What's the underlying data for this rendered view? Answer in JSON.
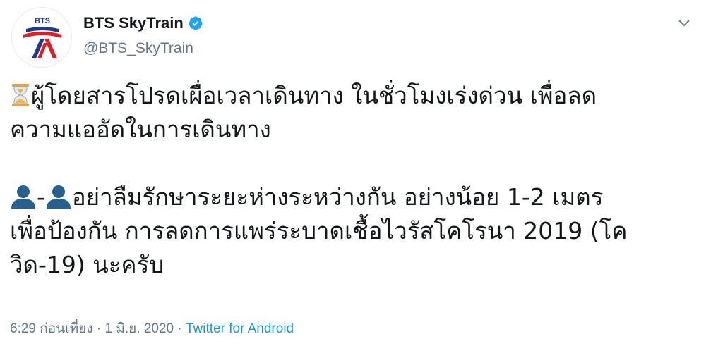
{
  "account": {
    "avatar_label": "BTS",
    "display_name": "BTS SkyTrain",
    "handle": "@BTS_SkyTrain",
    "verified": true
  },
  "tweet": {
    "line1": "ผู้โดยสารโปรดเผื่อเวลาเดินทาง ในชั่วโมงเร่งด่วน เพื่อลด",
    "line2": "ความแออัดในการเดินทาง",
    "line3_sep": "-",
    "line3": "อย่าลืมรักษาระยะห่างระหว่างกัน อย่างน้อย 1-2 เมตร",
    "line4": "เพื่อป้องกัน การลดการแพร่ระบาดเชื้อไวรัสโคโรนา 2019 (โค",
    "line5": "วิด-19) นะครับ"
  },
  "meta": {
    "time": "6:29 ก่อนเที่ยง",
    "dot1": " · ",
    "date": "1 มิ.ย. 2020",
    "dot2": " · ",
    "source": "Twitter for Android"
  },
  "icons": {
    "verified": "verified-badge-icon",
    "menu": "chevron-down-icon",
    "emoji1": "hourglass-icon",
    "emoji2": "person-silhouette-icon"
  },
  "colors": {
    "text": "#14171a",
    "secondary": "#657786",
    "link": "#1b95e0",
    "verified": "#1da1f2",
    "logo_blue": "#1e3a8a",
    "logo_red": "#e31b23"
  }
}
